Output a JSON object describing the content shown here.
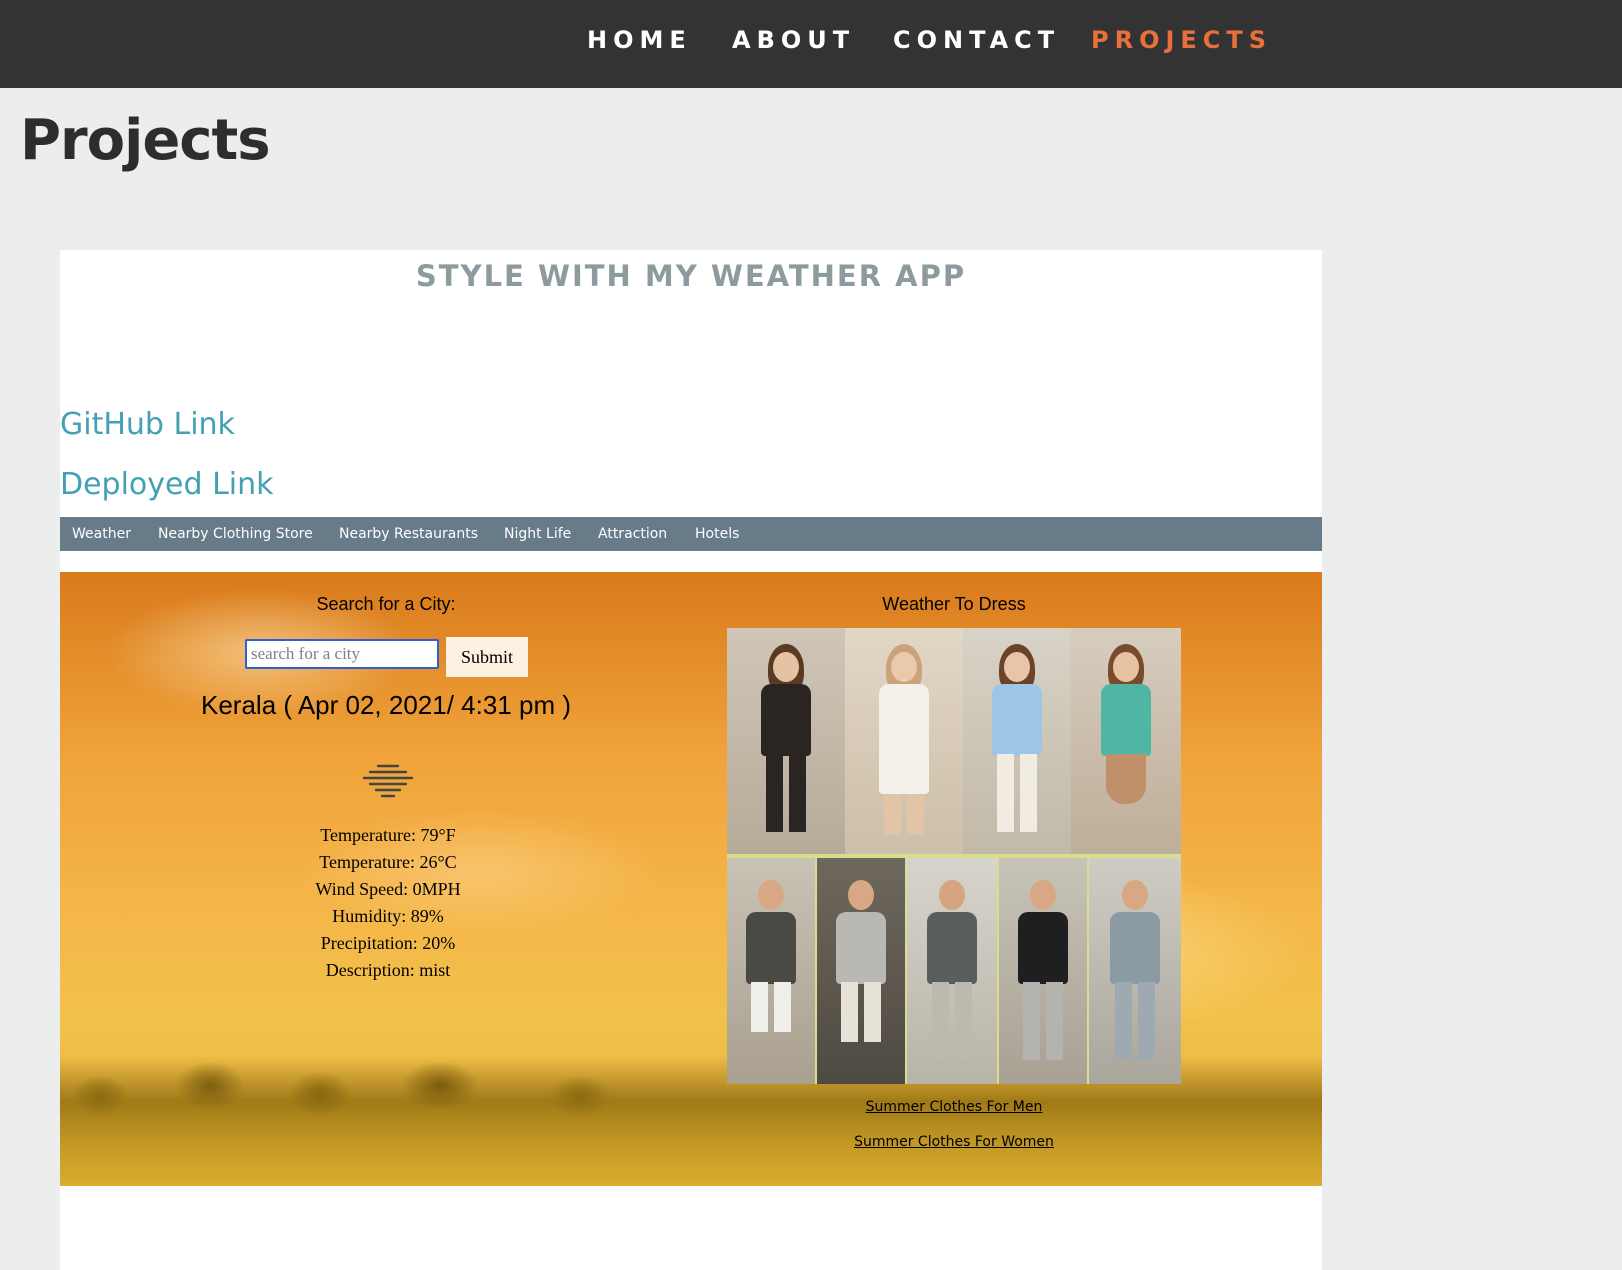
{
  "nav": {
    "items": [
      {
        "label": "HOME"
      },
      {
        "label": "ABOUT"
      },
      {
        "label": "CONTACT"
      },
      {
        "label": "PROJECTS"
      }
    ],
    "active_color": "#e8703a"
  },
  "page": {
    "title": "Projects"
  },
  "project": {
    "title": "STYLE WITH MY WEATHER APP",
    "github_label": "GitHub Link",
    "deployed_label": "Deployed Link",
    "link_color": "#44a1b4"
  },
  "app": {
    "nav_items": [
      {
        "label": "Weather"
      },
      {
        "label": "Nearby Clothing Store"
      },
      {
        "label": "Nearby Restaurants"
      },
      {
        "label": "Night Life"
      },
      {
        "label": "Attraction"
      },
      {
        "label": "Hotels"
      }
    ],
    "search": {
      "heading": "Search for a City:",
      "placeholder": "search for a city",
      "submit_label": "Submit"
    },
    "current": {
      "city_line": "Kerala ( Apr 02, 2021/ 4:31 pm )",
      "icon": "mist-icon",
      "stats": [
        "Temperature: 79°F",
        "Temperature: 26°C",
        "Wind Speed: 0MPH",
        "Humidity: 89%",
        "Precipitation: 20%",
        "Description: mist"
      ]
    },
    "dress": {
      "heading": "Weather To Dress",
      "men_link": "Summer Clothes For Men",
      "women_link": "Summer Clothes For Women"
    }
  }
}
